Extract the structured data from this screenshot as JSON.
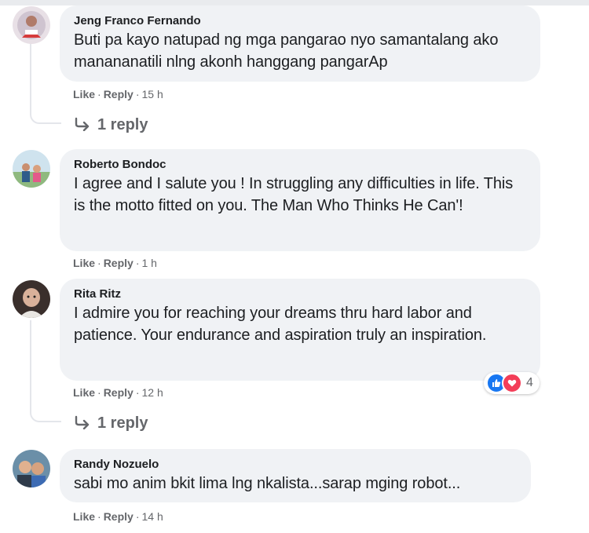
{
  "comments": [
    {
      "author": "Jeng Franco Fernando",
      "text": "Buti pa kayo natupad ng mga pangarao nyo samantalang ako manananatili nlng akonh hanggang pangarAp",
      "like": "Like",
      "reply": "Reply",
      "sep": "·",
      "time": "15 h",
      "replies_label": "1 reply"
    },
    {
      "author": "Roberto Bondoc",
      "text": "I agree and I salute you ! In struggling any difficulties in life. This is the motto fitted on you. The Man Who Thinks He Can'!",
      "like": "Like",
      "reply": "Reply",
      "sep": "·",
      "time": "1 h"
    },
    {
      "author": "Rita Ritz",
      "text": "I admire you for reaching your dreams thru hard labor and patience. Your endurance and aspiration truly an inspiration.",
      "like": "Like",
      "reply": "Reply",
      "sep": "·",
      "time": "12 h",
      "reaction_count": "4",
      "reactions": [
        "like-icon",
        "love-icon"
      ],
      "replies_label": "1 reply"
    },
    {
      "author": "Randy Nozuelo",
      "text": "sabi mo anim bkit lima lng nkalista...sarap mging robot...",
      "like": "Like",
      "reply": "Reply",
      "sep": "·",
      "time": "14 h"
    }
  ],
  "colors": {
    "bubble": "#f0f2f5",
    "text": "#1c1e21",
    "meta": "#65676b",
    "like_blue": "#1877f2",
    "love_red": "#f33e58"
  }
}
